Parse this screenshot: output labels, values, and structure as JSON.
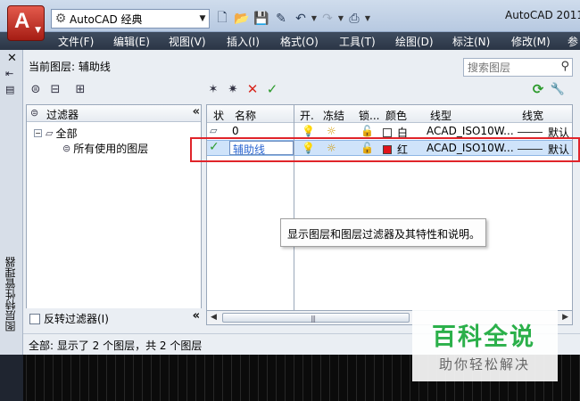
{
  "titlebar": {
    "workspace": "AutoCAD 经典",
    "app_title": "AutoCAD 2011"
  },
  "menu": [
    "文件(F)",
    "编辑(E)",
    "视图(V)",
    "插入(I)",
    "格式(O)",
    "工具(T)",
    "绘图(D)",
    "标注(N)",
    "修改(M)",
    "参"
  ],
  "palette": {
    "vertical_title": "图层特性管理器",
    "current_layer": "当前图层: 辅助线",
    "search_placeholder": "搜索图层",
    "filter_header": "过滤器",
    "tree": {
      "root": "全部",
      "child": "所有使用的图层"
    },
    "invert_filter": "反转过滤器(I)",
    "columns": [
      "状",
      "名称",
      "开.",
      "冻结",
      "锁...",
      "颜色",
      "线型",
      "线宽"
    ],
    "rows": [
      {
        "name": "0",
        "color_name": "白",
        "color": "#ffffff",
        "linetype": "ACAD_ISO10W...",
        "lineweight": "默认",
        "current": false
      },
      {
        "name": "辅助线",
        "color_name": "红",
        "color": "#e0141c",
        "linetype": "ACAD_ISO10W...",
        "lineweight": "默认",
        "current": true
      }
    ],
    "tooltip": "显示图层和图层过滤器及其特性和说明。",
    "status": "全部: 显示了 2 个图层，共 2 个图层"
  },
  "watermark": {
    "title": "百科全说",
    "subtitle": "助你轻松解决"
  }
}
